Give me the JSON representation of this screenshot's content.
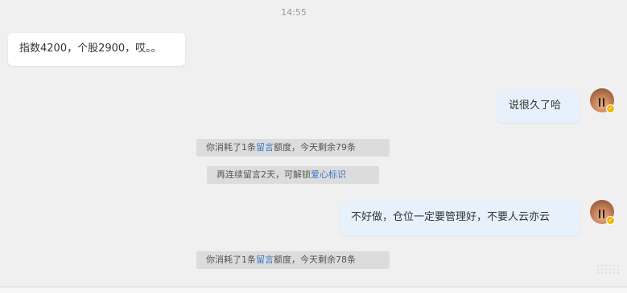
{
  "timestamp": "14:55",
  "messages": {
    "incoming_1": "指数4200，个股2900，哎。。",
    "outgoing_1": "说很久了哈",
    "outgoing_2": "不好做，仓位一定要管理好，不要人云亦云"
  },
  "system_notes": {
    "note_1": {
      "prefix": "你消耗了1条",
      "link": "留言",
      "suffix": "额度，今天剩余79条"
    },
    "note_2": {
      "prefix": "再连续留言2天，可解锁",
      "link": "爱心标识",
      "suffix": ""
    },
    "note_3": {
      "prefix": "你消耗了1条",
      "link": "留言",
      "suffix": "额度，今天剩余78条"
    }
  },
  "avatar": {
    "verified_badge": "✓",
    "badge_color": "#f5b400"
  },
  "colors": {
    "link": "#3a75c4",
    "outgoing_bubble": "#e6f1fb",
    "incoming_bubble": "#ffffff",
    "background": "#f0f0f0"
  }
}
